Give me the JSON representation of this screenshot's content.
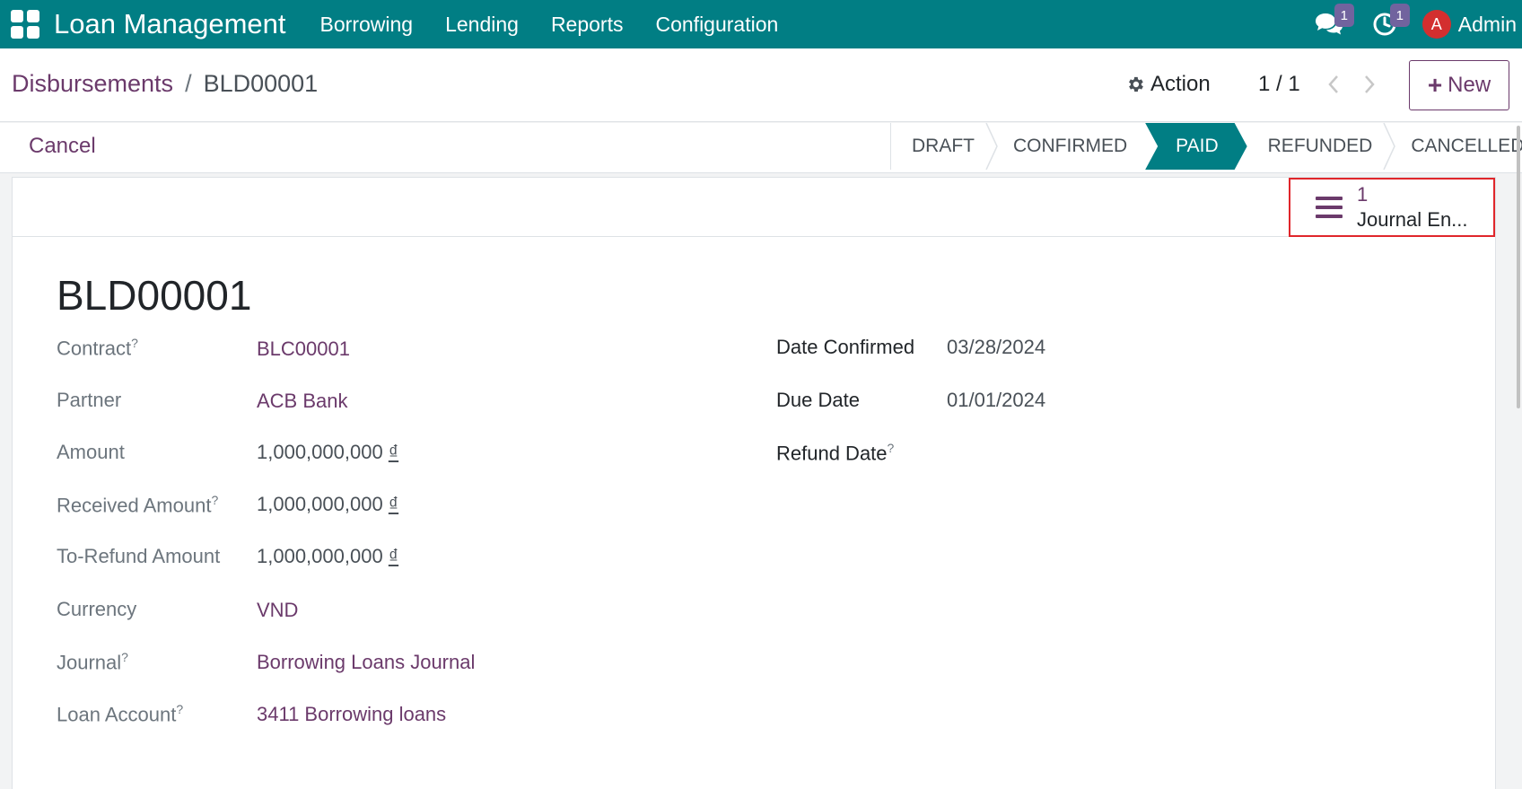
{
  "navbar": {
    "app_title": "Loan Management",
    "menu": [
      "Borrowing",
      "Lending",
      "Reports",
      "Configuration"
    ],
    "chat_badge": "1",
    "activity_badge": "1",
    "avatar_letter": "A",
    "user_name": "Admin",
    "color": "#017e84"
  },
  "breadcrumb": {
    "parent": "Disbursements",
    "separator": "/",
    "current": "BLD00001"
  },
  "control": {
    "action_label": "Action",
    "pager": "1 / 1",
    "new_label": "New"
  },
  "statusbar": {
    "cancel_label": "Cancel",
    "stages": [
      "DRAFT",
      "CONFIRMED",
      "PAID",
      "REFUNDED",
      "CANCELLED"
    ],
    "active_stage": "PAID"
  },
  "smart_button": {
    "count": "1",
    "label": "Journal En..."
  },
  "record": {
    "title": "BLD00001",
    "left_fields": [
      {
        "label": "Contract",
        "help": "?",
        "value": "BLC00001",
        "link": true
      },
      {
        "label": "Partner",
        "help": "",
        "value": "ACB Bank",
        "link": true
      },
      {
        "label": "Amount",
        "help": "",
        "amount": "1,000,000,000",
        "currency": "₫"
      },
      {
        "label": "Received Amount",
        "help": "?",
        "amount": "1,000,000,000",
        "currency": "₫"
      },
      {
        "label": "To-Refund Amount",
        "help": "",
        "amount": "1,000,000,000",
        "currency": "₫"
      },
      {
        "label": "Currency",
        "help": "",
        "value": "VND",
        "link": true
      },
      {
        "label": "Journal",
        "help": "?",
        "value": "Borrowing Loans Journal",
        "link": true
      },
      {
        "label": "Loan Account",
        "help": "?",
        "value": "3411 Borrowing loans",
        "link": true
      }
    ],
    "right_fields": [
      {
        "label": "Date Confirmed",
        "help": "",
        "value": "03/28/2024"
      },
      {
        "label": "Due Date",
        "help": "",
        "value": "01/01/2024"
      },
      {
        "label": "Refund Date",
        "help": "?",
        "value": ""
      }
    ]
  }
}
